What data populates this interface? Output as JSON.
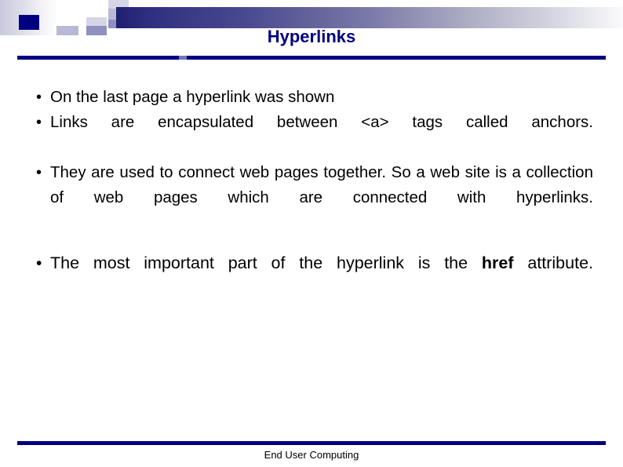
{
  "slide": {
    "title": "Hyperlinks",
    "footer": "End User Computing",
    "colors": {
      "navy": "#000080",
      "gradient_start": "#1f1f6e",
      "gradient_end": "#fbfbfd",
      "text": "#000000",
      "background": "#ffffff"
    },
    "bullets": [
      {
        "bullet_glyph": "•",
        "text": "On the last page a hyperlink was shown",
        "justified": false,
        "emphasis": null
      },
      {
        "bullet_glyph": "•",
        "text": "Links are encapsulated between <a> tags called anchors.",
        "justified": true,
        "emphasis": null
      },
      {
        "bullet_glyph": "•",
        "text": "They are used to connect web pages together. So a web site is a collection of web pages which are connected with hyperlinks.",
        "justified": true,
        "emphasis": null
      },
      {
        "bullet_glyph": "•",
        "text_before": "The most important part of the hyperlink is the ",
        "emphasis": "href",
        "text_after": " attribute.",
        "justified": true
      }
    ]
  }
}
